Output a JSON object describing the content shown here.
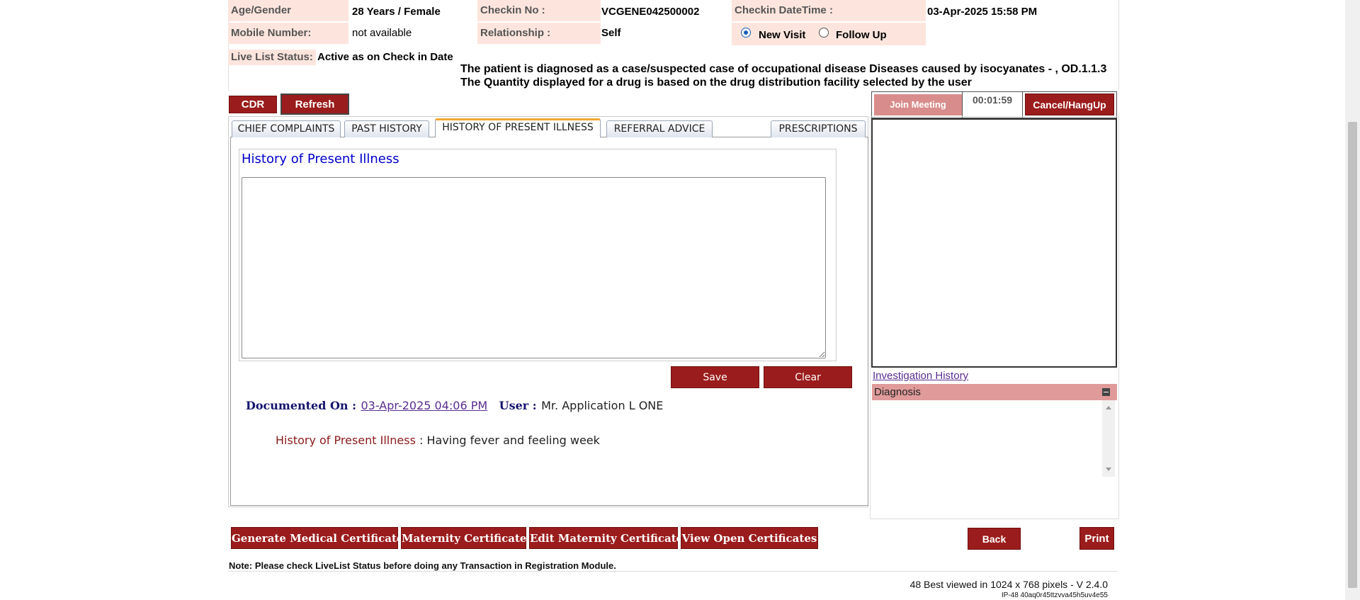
{
  "patient": {
    "age_gender_label": "Age/Gender",
    "age_gender_value": "28 Years / Female",
    "checkin_no_label": "Checkin No :",
    "checkin_no_value": "VCGENE042500002",
    "checkin_datetime_label": "Checkin DateTime :",
    "checkin_datetime_value": "03-Apr-2025 15:58 PM",
    "mobile_label": "Mobile Number:",
    "mobile_value": "not available",
    "relationship_label": "Relationship :",
    "relationship_value": "Self",
    "visit_new_label": "New Visit",
    "visit_followup_label": "Follow Up",
    "livelist_label": "Live List Status:",
    "livelist_value": "Active as on Check in Date"
  },
  "notices": {
    "line1": "The patient is diagnosed as a case/suspected case of occupational disease Diseases caused by isocyanates - , OD.1.1.3",
    "line2": "The Quantity displayed for a drug is based on the drug distribution facility selected by the user"
  },
  "toolbar": {
    "cdr_label": "CDR",
    "refresh_label": "Refresh"
  },
  "tabs": [
    {
      "label": "CHIEF COMPLAINTS"
    },
    {
      "label": "PAST HISTORY"
    },
    {
      "label": "HISTORY OF PRESENT ILLNESS"
    },
    {
      "label": "REFERRAL ADVICE"
    },
    {
      "label": "PRESCRIPTIONS"
    }
  ],
  "hpi": {
    "legend": "History of Present Illness",
    "textarea_value": "",
    "save_label": "Save",
    "clear_label": "Clear",
    "documented_on_label": "Documented On :",
    "documented_on_value": "03-Apr-2025 04:06 PM",
    "user_label": "User :",
    "user_value": "Mr. Application L ONE",
    "entry_label": "History of Present Illness",
    "entry_sep": ":",
    "entry_value": "Having fever and feeling week"
  },
  "meeting": {
    "join_label": "Join Meeting",
    "timer": "00:01:59",
    "cancel_label": "Cancel/HangUp"
  },
  "side": {
    "investigation_link": "Investigation History",
    "diagnosis_label": "Diagnosis"
  },
  "certificates": [
    {
      "label": "Generate Medical Certificate"
    },
    {
      "label": "Maternity Certificate"
    },
    {
      "label": "Edit Maternity Certificate"
    },
    {
      "label": "View Open Certificates"
    }
  ],
  "nav": {
    "back_label": "Back",
    "print_label": "Print"
  },
  "footer": {
    "note": "Note: Please check LiveList Status before doing any Transaction in Registration Module.",
    "version": "48 Best viewed in 1024 x 768 pixels - V 2.4.0",
    "ip": "IP-48 40aq0r45ttzvva45h5uv4e55"
  },
  "colors": {
    "accent_red": "#9b1c1c",
    "label_bg": "#fde5dd",
    "link_purple": "#5a2d91",
    "legend_blue": "#0000cc"
  }
}
